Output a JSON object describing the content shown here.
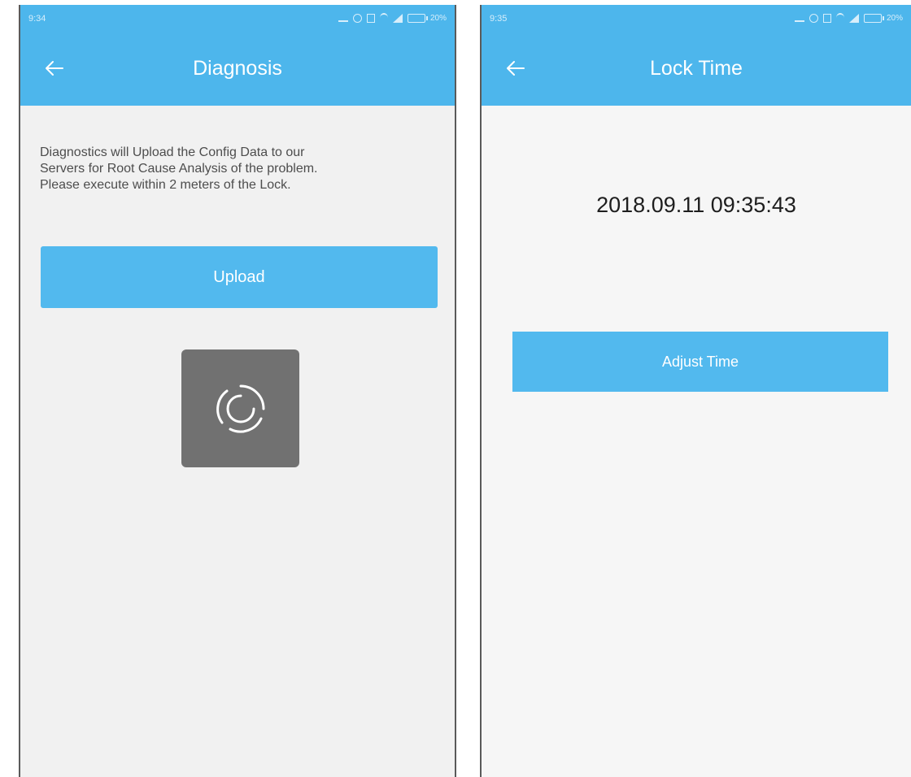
{
  "colors": {
    "primary": "#4db6ec",
    "button": "#52b9ee",
    "background_left": "#f1f1f1",
    "background_right": "#f6f6f6",
    "loader": "#717171"
  },
  "left_screen": {
    "status_bar": {
      "time": "9:34",
      "battery": "20%"
    },
    "app_bar": {
      "back_icon": "arrow-left-icon",
      "title": "Diagnosis"
    },
    "description": {
      "line1": "Diagnostics will Upload the Config Data to our",
      "line2": "Servers for Root Cause Analysis of the problem.",
      "line3": "Please execute within 2 meters of the Lock."
    },
    "upload_button": {
      "label": "Upload"
    },
    "loading_indicator": {
      "icon": "spinner-icon"
    }
  },
  "right_screen": {
    "status_bar": {
      "time": "9:35",
      "battery": "20%"
    },
    "app_bar": {
      "back_icon": "arrow-left-icon",
      "title": "Lock Time"
    },
    "lock_time": "2018.09.11 09:35:43",
    "adjust_button": {
      "label": "Adjust Time"
    }
  }
}
